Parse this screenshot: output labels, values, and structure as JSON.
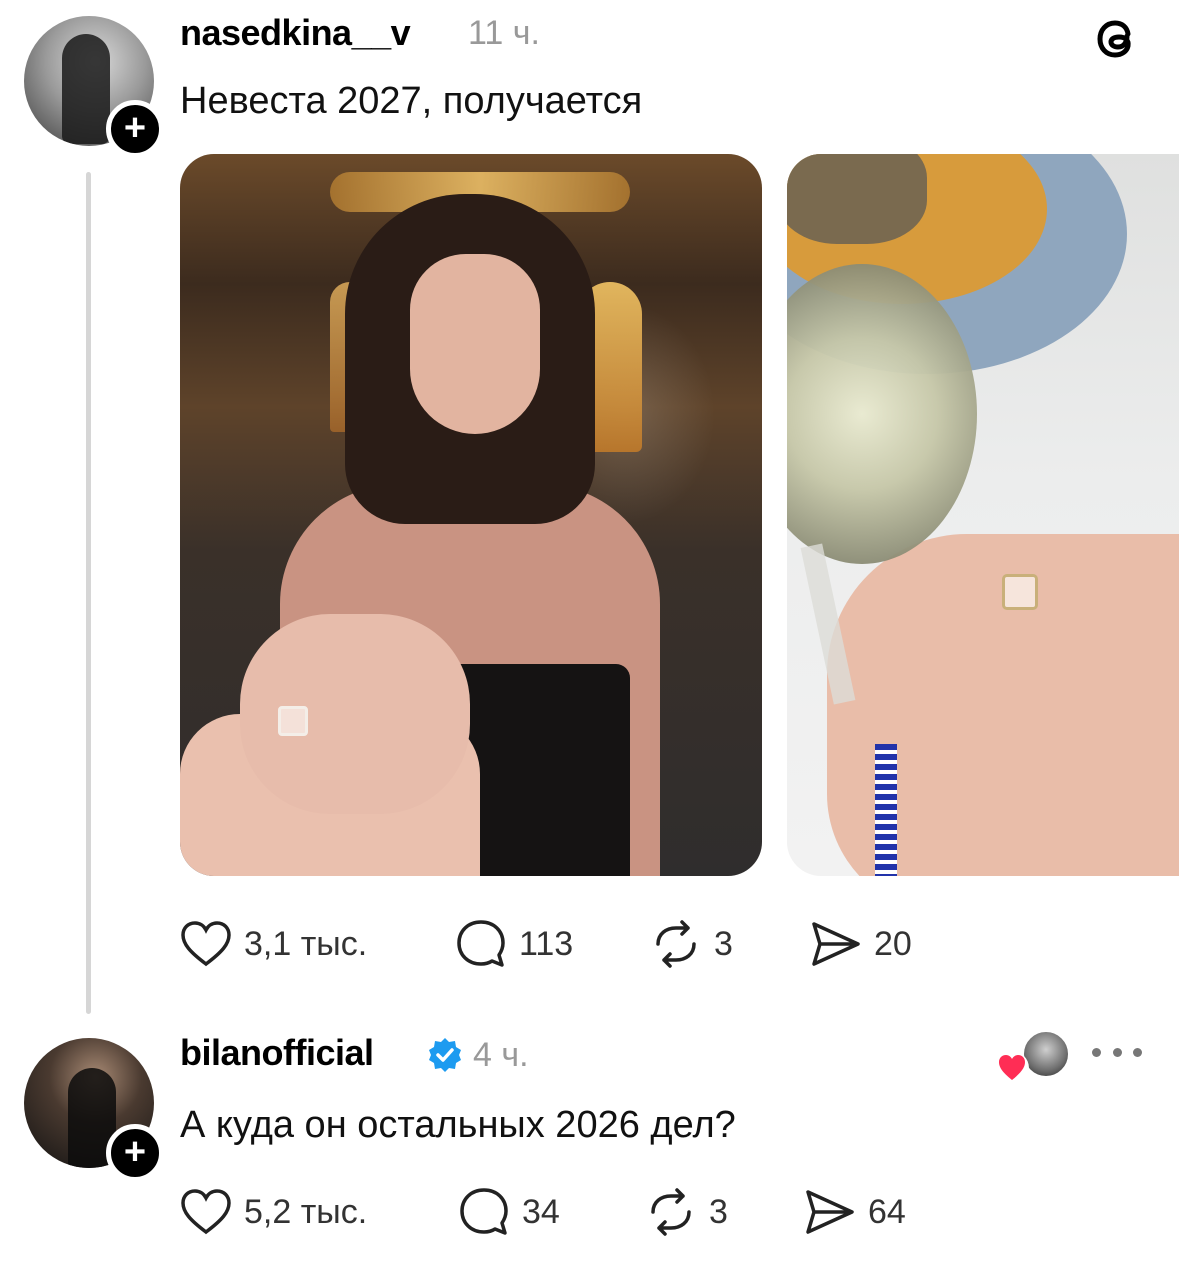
{
  "post": {
    "username": "nasedkina__v",
    "time": "11 ч.",
    "text": "Невеста 2027, получается",
    "likes": "3,1 тыс.",
    "comments": "113",
    "reposts": "3",
    "shares": "20"
  },
  "reply": {
    "username": "bilanofficial",
    "time": "4 ч.",
    "text": "А куда он остальных 2026 дел?",
    "likes": "5,2 тыс.",
    "comments": "34",
    "reposts": "3",
    "shares": "64"
  },
  "icons": {
    "app": "threads-icon",
    "like": "heart-icon",
    "comment": "comment-icon",
    "repost": "repost-icon",
    "share": "send-icon",
    "verified": "verified-badge-icon",
    "follow": "plus-icon",
    "more": "more-icon"
  },
  "colors": {
    "accent_verified": "#1d9bf0",
    "liked_heart": "#ff2d55",
    "secondary_text": "#999999",
    "thread_line": "#d6d6d6"
  }
}
